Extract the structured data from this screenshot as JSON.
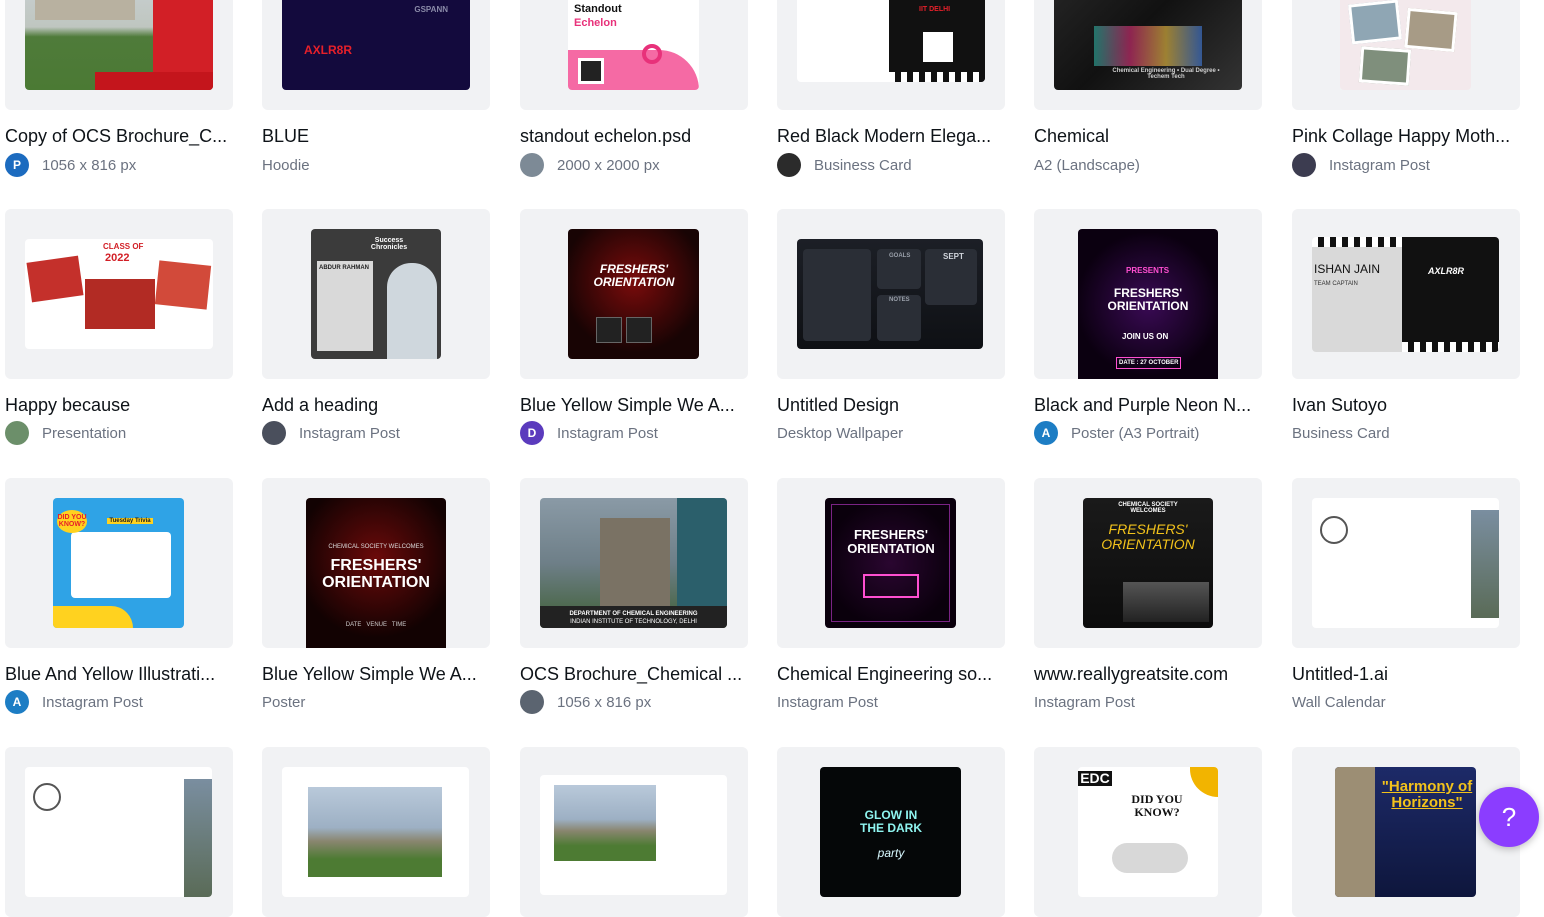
{
  "cards": [
    {
      "title": "Copy of OCS Brochure_C...",
      "meta": "1056 x 816 px",
      "avatar": "P"
    },
    {
      "title": "BLUE",
      "meta": "Hoodie",
      "avatar": ""
    },
    {
      "title": "standout echelon.psd",
      "meta": "2000 x 2000 px",
      "avatar": ""
    },
    {
      "title": "Red Black Modern Elega...",
      "meta": "Business Card",
      "avatar": ""
    },
    {
      "title": "Chemical",
      "meta": "A2 (Landscape)",
      "avatar": ""
    },
    {
      "title": "Pink Collage Happy Moth...",
      "meta": "Instagram Post",
      "avatar": ""
    },
    {
      "title": "Happy because",
      "meta": "Presentation",
      "avatar": ""
    },
    {
      "title": "Add a heading",
      "meta": "Instagram Post",
      "avatar": ""
    },
    {
      "title": "Blue Yellow Simple We A...",
      "meta": "Instagram Post",
      "avatar": "D"
    },
    {
      "title": "Untitled Design",
      "meta": "Desktop Wallpaper",
      "avatar": ""
    },
    {
      "title": "Black and Purple Neon N...",
      "meta": "Poster (A3 Portrait)",
      "avatar": "A"
    },
    {
      "title": "Ivan Sutoyo",
      "meta": "Business Card",
      "avatar": ""
    },
    {
      "title": "Blue And Yellow Illustrati...",
      "meta": "Instagram Post",
      "avatar": "A"
    },
    {
      "title": "Blue Yellow Simple We A...",
      "meta": "Poster",
      "avatar": ""
    },
    {
      "title": "OCS Brochure_Chemical ...",
      "meta": "1056 x 816 px",
      "avatar": ""
    },
    {
      "title": "Chemical Engineering so...",
      "meta": "Instagram Post",
      "avatar": ""
    },
    {
      "title": "www.reallygreatsite.com",
      "meta": "Instagram Post",
      "avatar": ""
    },
    {
      "title": "Untitled-1.ai",
      "meta": "Wall Calendar",
      "avatar": ""
    }
  ],
  "art_text": {
    "blue_hoodie": "AXLR8R",
    "blue_hoodie_brand": "GSPANN",
    "standout": "Standout",
    "echelon": "Echelon",
    "dept": "DEPARTMENT OF CHEMICAL ENGINEERING",
    "iit": "INDIAN INSTITUTE OF TECHNOLOGY, DELHI",
    "class_of": "CLASS OF",
    "year_2022": "2022",
    "success": "Success Chronicles",
    "abdur": "ABDUR RAHMAN",
    "freshers": "FRESHERS' ORIENTATION",
    "presents": "PRESENTS",
    "join_us": "JOIN US ON",
    "date_oct": "DATE : 27 OCTOBER",
    "ishan": "ISHAN JAIN",
    "team_captain": "TEAM CAPTAIN",
    "axlr8r_small": "AXLR8R",
    "tuesday": "Tuesday Trivia",
    "did_you_know": "DID YOU KNOW?",
    "glow": "GLOW IN THE DARK",
    "party": "party",
    "edc": "EDC",
    "harmony": "\"Harmony of Horizons\"",
    "sept": "SEPT",
    "notes": "NOTES",
    "goals": "GOALS",
    "iit_delhi": "IIT DELHI",
    "chem_dual": "Chemical Engineering • Dual Degree • Techem Tech",
    "welcomes": "CHEMICAL SOCIETY WELCOMES",
    "date_venue_time": "DATE   VENUE   TIME"
  },
  "help_fab": {
    "label": "?"
  },
  "colors": {
    "accent": "#8b3dff",
    "thumb_bg": "#f1f2f4"
  }
}
